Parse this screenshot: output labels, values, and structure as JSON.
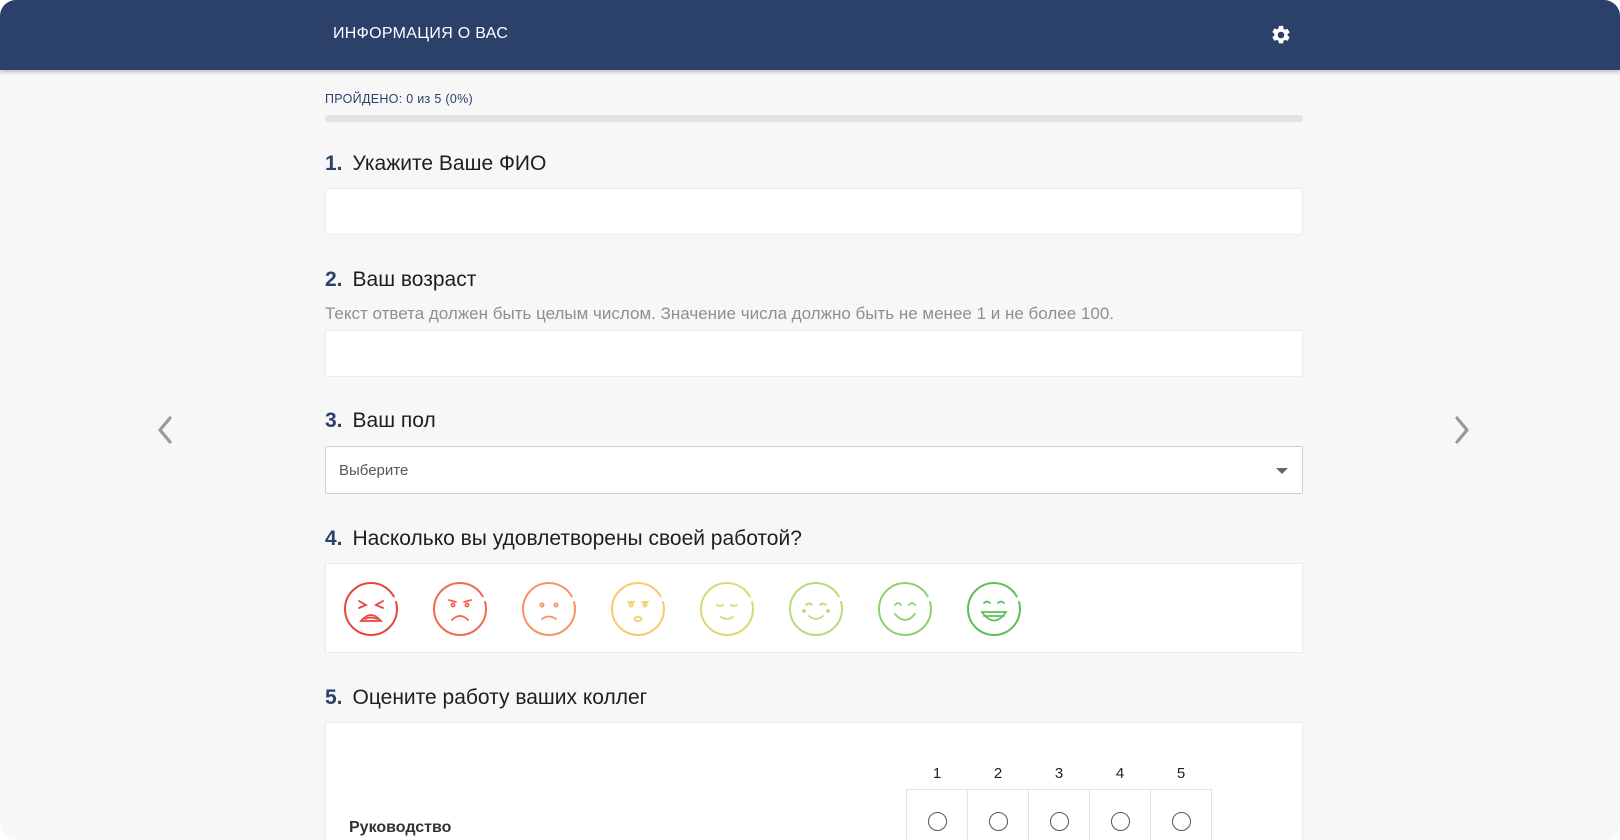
{
  "header": {
    "title": "ИНФОРМАЦИЯ О ВАС",
    "settings_icon": "gear-icon"
  },
  "navigation": {
    "prev_icon": "chevron-left-icon",
    "next_icon": "chevron-right-icon"
  },
  "progress": {
    "label": "ПРОЙДЕНО: 0 из 5 (0%)",
    "completed": 0,
    "total": 5,
    "percent": 0
  },
  "questions": {
    "q1": {
      "number": "1.",
      "title": "Укажите Ваше ФИО",
      "value": "",
      "placeholder": ""
    },
    "q2": {
      "number": "2.",
      "title": "Ваш возраст",
      "description": "Текст ответа должен быть целым числом. Значение числа должно быть не менее 1 и не более 100.",
      "value": "",
      "placeholder": ""
    },
    "q3": {
      "number": "3.",
      "title": "Ваш пол",
      "selected": "Выберите"
    },
    "q4": {
      "number": "4.",
      "title": "Насколько вы удовлетворены своей работой?",
      "faces": [
        {
          "name": "face-crying-icon",
          "color": "#e8453c"
        },
        {
          "name": "face-sad-icon",
          "color": "#ef6b4c"
        },
        {
          "name": "face-worried-icon",
          "color": "#f4955e"
        },
        {
          "name": "face-uneasy-icon",
          "color": "#f5cc6a"
        },
        {
          "name": "face-neutral-icon",
          "color": "#dcd872"
        },
        {
          "name": "face-slight-smile-icon",
          "color": "#b8dc7a"
        },
        {
          "name": "face-smile-icon",
          "color": "#8fd06e"
        },
        {
          "name": "face-grin-icon",
          "color": "#5cc05a"
        }
      ]
    },
    "q5": {
      "number": "5.",
      "title": "Оцените работу ваших коллег",
      "columns": [
        "1",
        "2",
        "3",
        "4",
        "5"
      ],
      "rows": [
        {
          "label": "Руководство"
        }
      ]
    }
  },
  "colors": {
    "brand": "#2b416a",
    "background": "#f7f7f7"
  }
}
